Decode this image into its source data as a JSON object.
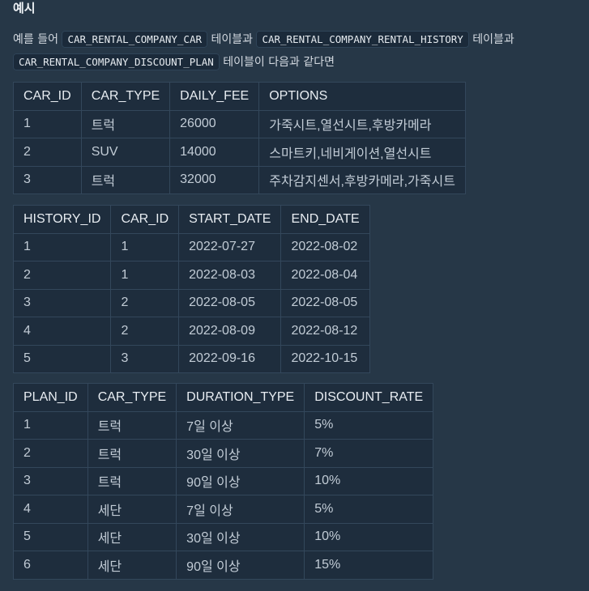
{
  "heading": "예시",
  "intro": {
    "part1": "예를 들어",
    "code1": "CAR_RENTAL_COMPANY_CAR",
    "part2": "테이블과",
    "code2": "CAR_RENTAL_COMPANY_RENTAL_HISTORY",
    "part3": "테이블과",
    "code3": "CAR_RENTAL_COMPANY_DISCOUNT_PLAN",
    "part4": "테이블이 다음과 같다면"
  },
  "tables": [
    {
      "headers": [
        "CAR_ID",
        "CAR_TYPE",
        "DAILY_FEE",
        "OPTIONS"
      ],
      "rows": [
        [
          "1",
          "트럭",
          "26000",
          "가죽시트,열선시트,후방카메라"
        ],
        [
          "2",
          "SUV",
          "14000",
          "스마트키,네비게이션,열선시트"
        ],
        [
          "3",
          "트럭",
          "32000",
          "주차감지센서,후방카메라,가죽시트"
        ]
      ]
    },
    {
      "headers": [
        "HISTORY_ID",
        "CAR_ID",
        "START_DATE",
        "END_DATE"
      ],
      "rows": [
        [
          "1",
          "1",
          "2022-07-27",
          "2022-08-02"
        ],
        [
          "2",
          "1",
          "2022-08-03",
          "2022-08-04"
        ],
        [
          "3",
          "2",
          "2022-08-05",
          "2022-08-05"
        ],
        [
          "4",
          "2",
          "2022-08-09",
          "2022-08-12"
        ],
        [
          "5",
          "3",
          "2022-09-16",
          "2022-10-15"
        ]
      ]
    },
    {
      "headers": [
        "PLAN_ID",
        "CAR_TYPE",
        "DURATION_TYPE",
        "DISCOUNT_RATE"
      ],
      "rows": [
        [
          "1",
          "트럭",
          "7일 이상",
          "5%"
        ],
        [
          "2",
          "트럭",
          "30일 이상",
          "7%"
        ],
        [
          "3",
          "트럭",
          "90일 이상",
          "10%"
        ],
        [
          "4",
          "세단",
          "7일 이상",
          "5%"
        ],
        [
          "5",
          "세단",
          "30일 이상",
          "10%"
        ],
        [
          "6",
          "세단",
          "90일 이상",
          "15%"
        ]
      ]
    }
  ]
}
